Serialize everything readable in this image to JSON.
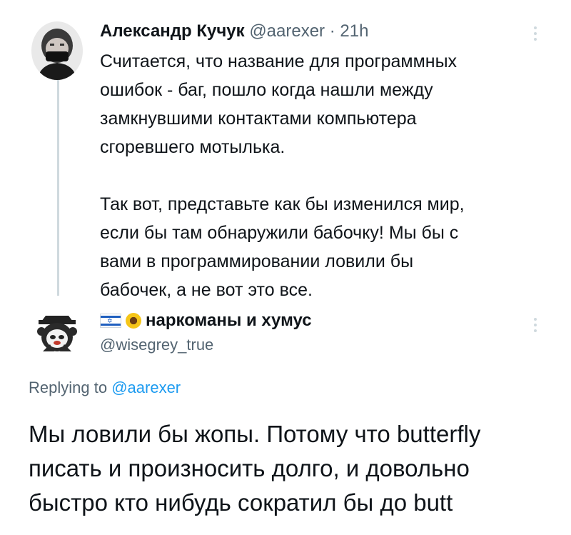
{
  "tweet": {
    "author_name": "Александр Кучук",
    "handle": "@aarexer",
    "separator": "·",
    "time": "21h",
    "text_lines_p1": [
      "Считается, что  название для программных",
      "ошибок - баг, пошло когда нашли между",
      "замкнувшими контактами компьютера",
      "сгоревшего мотылька."
    ],
    "text_lines_p2": [
      "Так вот, представьте как бы изменился мир,",
      "если бы там обнаружили бабочку! Мы бы с",
      "вами в программировании ловили бы",
      "бабочек, а не вот это все."
    ]
  },
  "reply": {
    "author_name": "наркоманы и хумус",
    "handle": "@wisegrey_true",
    "replying_to_prefix": "Replying to",
    "replying_to_mention": "@aarexer",
    "text_lines": [
      "Мы ловили бы жопы. Потому что butterfly",
      "писать и произносить долго, и довольно",
      "быстро кто нибудь сократил бы до butt"
    ]
  },
  "icons": {
    "avatar1": "masked-person-avatar",
    "avatar2": "panda-hat-avatar",
    "flag": "israel-flag-emoji",
    "sunflower": "sunflower-emoji",
    "more": "more-options-icon"
  }
}
